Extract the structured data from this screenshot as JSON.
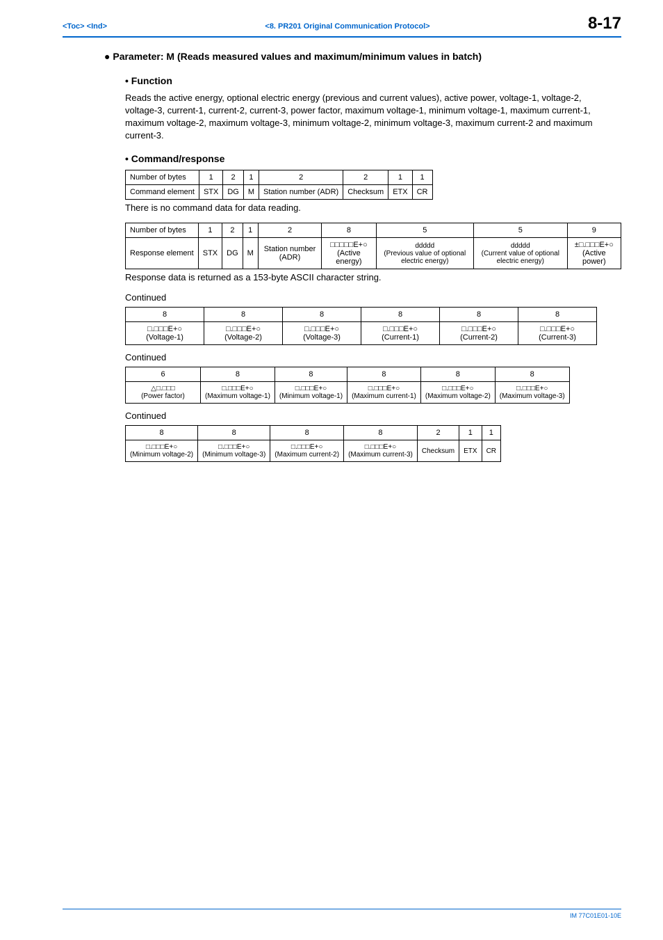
{
  "header": {
    "toc": "<Toc>",
    "ind": "<Ind>",
    "chapter": "<8.  PR201 Original Communication Protocol>",
    "pagenum": "8-17"
  },
  "section": {
    "title": "Parameter: M (Reads measured values and maximum/minimum values in batch)",
    "function_h": "Function",
    "function_body": "Reads the active energy, optional electric energy (previous and current values), active power, voltage-1, voltage-2, voltage-3, current-1, current-2, current-3, power factor, maximum voltage-1, minimum voltage-1, maximum current-1, maximum voltage-2, maximum voltage-3, minimum voltage-2, minimum voltage-3, maximum current-2 and maximum current-3.",
    "cmd_h": "Command/response",
    "cmd_note": "There is no command data for data reading.",
    "resp_note": "Response data is returned as a 153-byte ASCII character string.",
    "continued": "Continued"
  },
  "cmd_table": {
    "row_h1": "Number of bytes",
    "row_h2": "Command element",
    "b": [
      "1",
      "2",
      "1",
      "2",
      "2",
      "1",
      "1"
    ],
    "e": [
      "STX",
      "DG",
      "M",
      "Station number (ADR)",
      "Checksum",
      "ETX",
      "CR"
    ]
  },
  "resp_table": {
    "row_h1": "Number of bytes",
    "row_h2": "Response element",
    "b": [
      "1",
      "2",
      "1",
      "2",
      "8",
      "5",
      "5",
      "9"
    ],
    "e_stx": "STX",
    "e_dg": "DG",
    "e_m": "M",
    "e_adr": "Station number (ADR)",
    "e_ae_fmt": "□□□□□E+○",
    "e_ae_lbl": "(Active energy)",
    "e_prev_val": "ddddd",
    "e_prev_lbl": "(Previous value of optional electric energy)",
    "e_cur_val": "ddddd",
    "e_cur_lbl": "(Current value of optional electric energy)",
    "e_ap_fmt": "±□.□□□E+○",
    "e_ap_lbl": "(Active power)"
  },
  "cont1": {
    "b": [
      "8",
      "8",
      "8",
      "8",
      "8",
      "8"
    ],
    "fmt": [
      "□.□□□E+○",
      "□.□□□E+○",
      "□.□□□E+○",
      "□.□□□E+○",
      "□.□□□E+○",
      "□.□□□E+○"
    ],
    "lbl": [
      "(Voltage-1)",
      "(Voltage-2)",
      "(Voltage-3)",
      "(Current-1)",
      "(Current-2)",
      "(Current-3)"
    ]
  },
  "cont2": {
    "b": [
      "6",
      "8",
      "8",
      "8",
      "8",
      "8"
    ],
    "fmt": [
      "△□.□□□",
      "□.□□□E+○",
      "□.□□□E+○",
      "□.□□□E+○",
      "□.□□□E+○",
      "□.□□□E+○"
    ],
    "lbl": [
      "(Power factor)",
      "(Maximum voltage-1)",
      "(Minimum voltage-1)",
      "(Maximum current-1)",
      "(Maximum voltage-2)",
      "(Maximum voltage-3)"
    ]
  },
  "cont3": {
    "b": [
      "8",
      "8",
      "8",
      "8",
      "2",
      "1",
      "1"
    ],
    "fmt": [
      "□.□□□E+○",
      "□.□□□E+○",
      "□.□□□E+○",
      "□.□□□E+○",
      "Checksum",
      "ETX",
      "CR"
    ],
    "lbl": [
      "(Minimum voltage-2)",
      "(Minimum voltage-3)",
      "(Maximum current-2)",
      "(Maximum current-3)",
      "",
      "",
      ""
    ]
  },
  "footer": "IM 77C01E01-10E"
}
